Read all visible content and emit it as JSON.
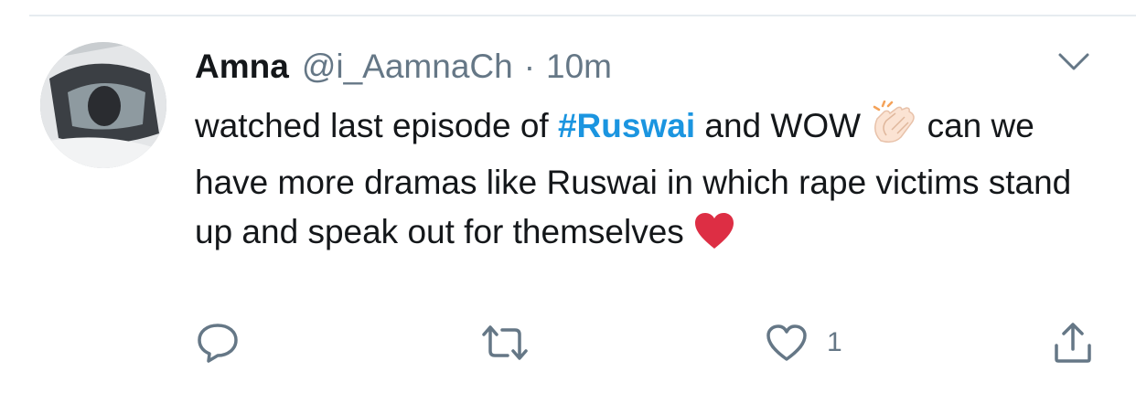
{
  "tweet": {
    "author_name": "Amna",
    "handle": "@i_AamnaCh",
    "separator": "·",
    "time": "10m",
    "text_part1": "watched last episode of ",
    "hashtag": "#Ruswai",
    "text_part2": " and WOW ",
    "text_part3": " can we have more dramas like Ruswai in which rape victims stand up and speak out for themselves ",
    "emoji_1": "clapping-hands-emoji",
    "emoji_2": "red-heart-emoji"
  },
  "actions": {
    "reply_count": "",
    "retweet_count": "",
    "like_count": "1"
  },
  "colors": {
    "text": "#14171a",
    "secondary": "#657786",
    "link": "#1b95e0",
    "heart": "#e0245e",
    "divider": "#e6ecf0"
  }
}
